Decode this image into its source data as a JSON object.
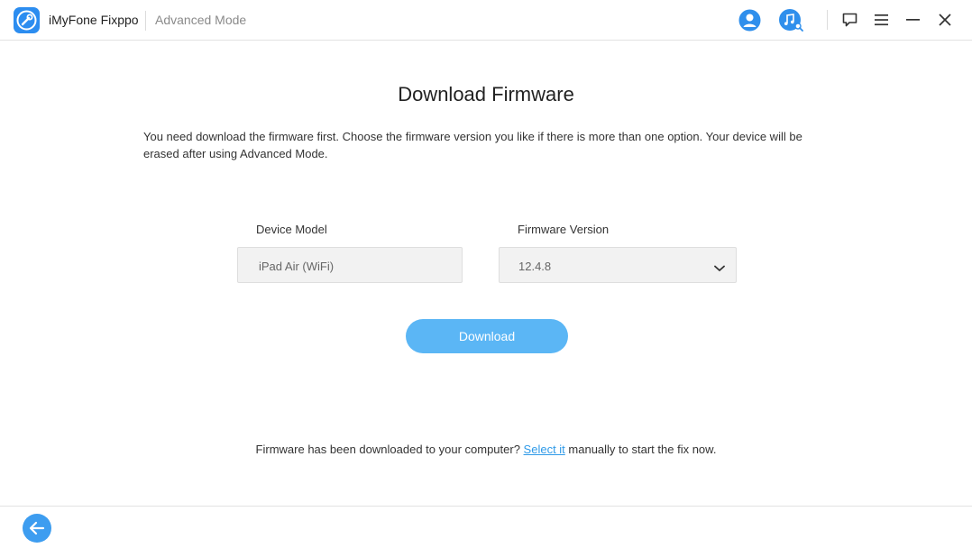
{
  "window": {
    "app_name": "iMyFone Fixppo",
    "mode": "Advanced Mode",
    "icons": [
      "wrench-logo-icon",
      "user-icon",
      "music-search-icon",
      "feedback-icon",
      "menu-icon",
      "minimize-icon",
      "close-icon"
    ]
  },
  "main": {
    "title": "Download Firmware",
    "description": "You need download the firmware first. Choose the firmware version you like if there is more than one option. Your device will be erased after using Advanced Mode.",
    "device_model": {
      "label": "Device Model",
      "value": "iPad Air (WiFi)"
    },
    "firmware_version": {
      "label": "Firmware Version",
      "value": "12.4.8"
    },
    "download_button": "Download",
    "hint": {
      "prefix": "Firmware has been downloaded to your computer? ",
      "link": "Select it",
      "suffix": " manually to start the fix now."
    }
  },
  "colors": {
    "accent": "#5bb6f5",
    "link": "#2f9ae8",
    "logo": "#2c8df0",
    "back": "#3d9df0"
  }
}
